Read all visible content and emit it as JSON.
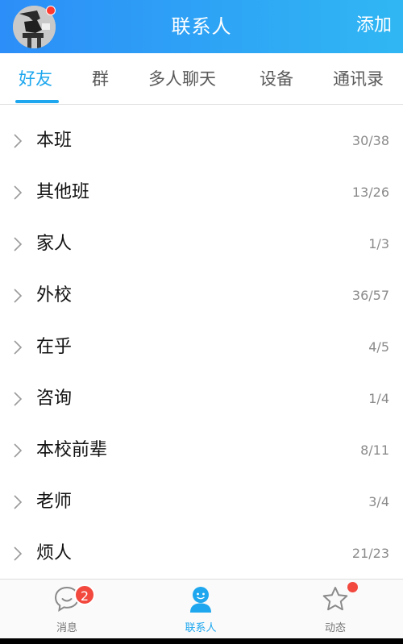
{
  "header": {
    "title": "联系人",
    "action_label": "添加"
  },
  "tabs": [
    {
      "label": "好友",
      "active": true
    },
    {
      "label": "群",
      "active": false
    },
    {
      "label": "多人聊天",
      "active": false
    },
    {
      "label": "设备",
      "active": false
    },
    {
      "label": "通讯录",
      "active": false
    }
  ],
  "groups": [
    {
      "name": "本班",
      "count": "30/38"
    },
    {
      "name": "其他班",
      "count": "13/26"
    },
    {
      "name": "家人",
      "count": "1/3"
    },
    {
      "name": "外校",
      "count": "36/57"
    },
    {
      "name": "在乎",
      "count": "4/5"
    },
    {
      "name": "咨询",
      "count": "1/4"
    },
    {
      "name": "本校前辈",
      "count": "8/11"
    },
    {
      "name": "老师",
      "count": "3/4"
    },
    {
      "name": "烦人",
      "count": "21/23"
    }
  ],
  "bottom_nav": {
    "messages": {
      "label": "消息",
      "badge": "2",
      "icon": "chat-bubble-icon"
    },
    "contacts": {
      "label": "联系人",
      "icon": "person-icon",
      "active": true
    },
    "moments": {
      "label": "动态",
      "icon": "star-icon"
    }
  },
  "colors": {
    "accent": "#1ea7ee",
    "header_start": "#2c8ef8",
    "header_end": "#30b7f3",
    "badge": "#f2483e"
  }
}
